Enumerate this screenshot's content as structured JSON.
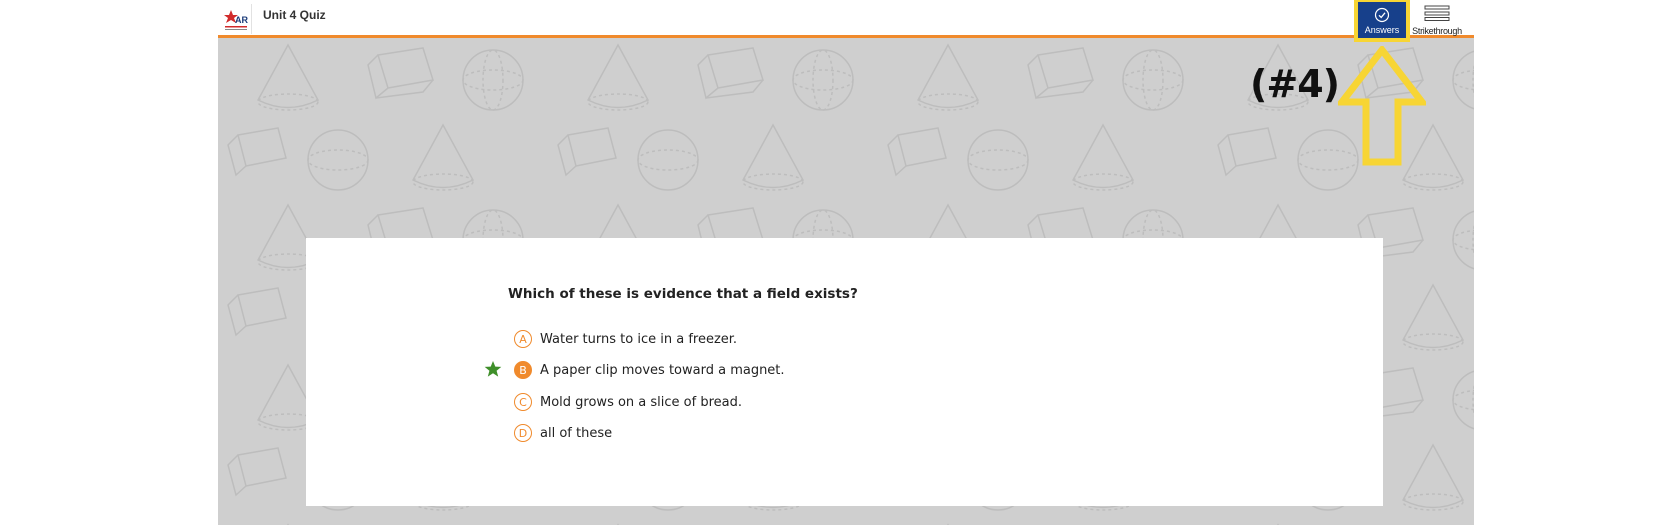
{
  "header": {
    "title": "Unit 4 Quiz"
  },
  "toolbar": {
    "answers_label": "Answers",
    "strikethrough_label": "Strikethrough"
  },
  "annotation": {
    "callout": "(#4)"
  },
  "question": {
    "text": "Which of these is evidence that a field exists?",
    "options": [
      {
        "letter": "A",
        "text": "Water turns to ice in a freezer.",
        "selected": false
      },
      {
        "letter": "B",
        "text": "A paper clip moves toward a magnet.",
        "selected": true
      },
      {
        "letter": "C",
        "text": "Mold grows on a slice of bread.",
        "selected": false
      },
      {
        "letter": "D",
        "text": "all of these",
        "selected": false
      }
    ]
  },
  "colors": {
    "accent_orange": "#f08a2c",
    "answers_blue": "#17408b",
    "highlight_yellow": "#f7d534",
    "star_green": "#3f8f2a",
    "background_gray": "#cfcfcf"
  },
  "icons": {
    "answers": "check-circle-icon",
    "strikethrough": "strikethrough-icon",
    "correct_marker": "star-icon",
    "logo": "star-logo-icon"
  }
}
